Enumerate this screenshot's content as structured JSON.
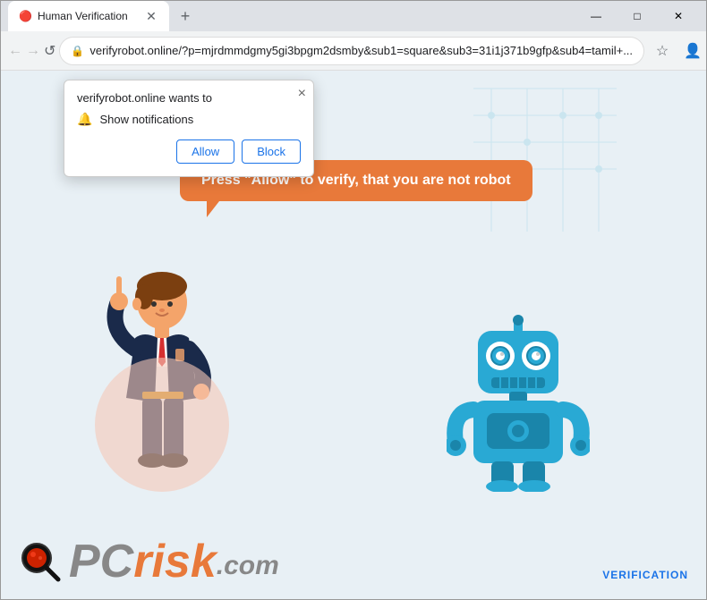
{
  "window": {
    "title": "Human Verification",
    "favicon": "🔴"
  },
  "titlebar": {
    "tab_label": "Human Verification",
    "new_tab_label": "+",
    "minimize": "—",
    "maximize": "□",
    "close": "✕"
  },
  "toolbar": {
    "back_label": "←",
    "forward_label": "→",
    "refresh_label": "↺",
    "address": "verifyrobot.online/?p=mjrdmmdgmy5gi3bpgm2dsmby&sub1=square&sub3=31i1j371b9gfp&sub4=tamil+...",
    "lock_icon": "🔒"
  },
  "popup": {
    "title": "verifyrobot.online wants to",
    "notification_label": "Show notifications",
    "allow_label": "Allow",
    "block_label": "Block",
    "close_label": "×"
  },
  "speech_bubble": {
    "text": "Press \"Allow\" to verify, that you are not robot"
  },
  "logo": {
    "pc_text": "PC",
    "risk_text": "risk",
    "dotcom_text": ".com"
  },
  "verification": {
    "label": "VERIFICATION"
  },
  "colors": {
    "orange": "#e8793a",
    "blue": "#1a73e8",
    "robot_blue": "#29a9d4"
  }
}
